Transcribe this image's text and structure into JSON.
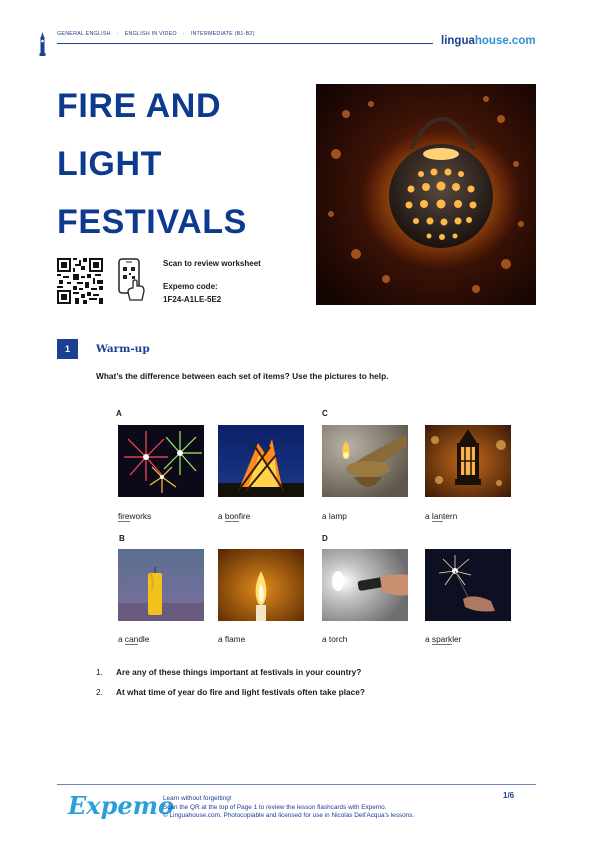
{
  "header": {
    "breadcrumb": [
      "GENERAL ENGLISH",
      "ENGLISH IN VIDEO",
      "INTERMEDIATE (B1-B2)"
    ],
    "separator": "·",
    "brand_main": "lingua",
    "brand_accent": "house.com"
  },
  "title_lines": [
    "FIRE AND",
    "LIGHT",
    "FESTIVALS"
  ],
  "qr_block": {
    "scan_text": "Scan to review worksheet",
    "code_label": "Expemo code:",
    "code_value": "1F24-A1LE-5E2"
  },
  "section": {
    "number": "1",
    "title": "Warm-up",
    "instruction": "What’s the difference between each set of items? Use the pictures to help."
  },
  "groups": [
    {
      "label": "A"
    },
    {
      "label": "B"
    },
    {
      "label": "C"
    },
    {
      "label": "D"
    }
  ],
  "items": [
    {
      "pre": "",
      "u": "fire",
      "post": "works"
    },
    {
      "pre": "a ",
      "u": "bon",
      "post": "fire"
    },
    {
      "pre": "a lamp",
      "u": "",
      "post": ""
    },
    {
      "pre": "a ",
      "u": "lan",
      "post": "tern"
    },
    {
      "pre": "a ",
      "u": "can",
      "post": "dle"
    },
    {
      "pre": "a flame",
      "u": "",
      "post": ""
    },
    {
      "pre": "a torch",
      "u": "",
      "post": ""
    },
    {
      "pre": "a ",
      "u": "spark",
      "post": "ler"
    }
  ],
  "questions": [
    {
      "num": "1.",
      "text": "Are any of these things important at festivals in your country?"
    },
    {
      "num": "2.",
      "text": "At what time of year do fire and light festivals often take place?"
    }
  ],
  "footer": {
    "logo": "Expemo",
    "line1": "Learn without forgetting!",
    "line2": "Scan the QR at the top of Page 1 to review the lesson flashcards with Expemo.",
    "line3": "© Linguahouse.com. Photocopiable and licensed for use in Nicolas Dell'Acqua's lessons.",
    "page": "1/6"
  },
  "colors": {
    "brand_blue": "#1c3f91",
    "title_blue": "#0d3a8e",
    "accent_blue": "#2a9fd8"
  }
}
